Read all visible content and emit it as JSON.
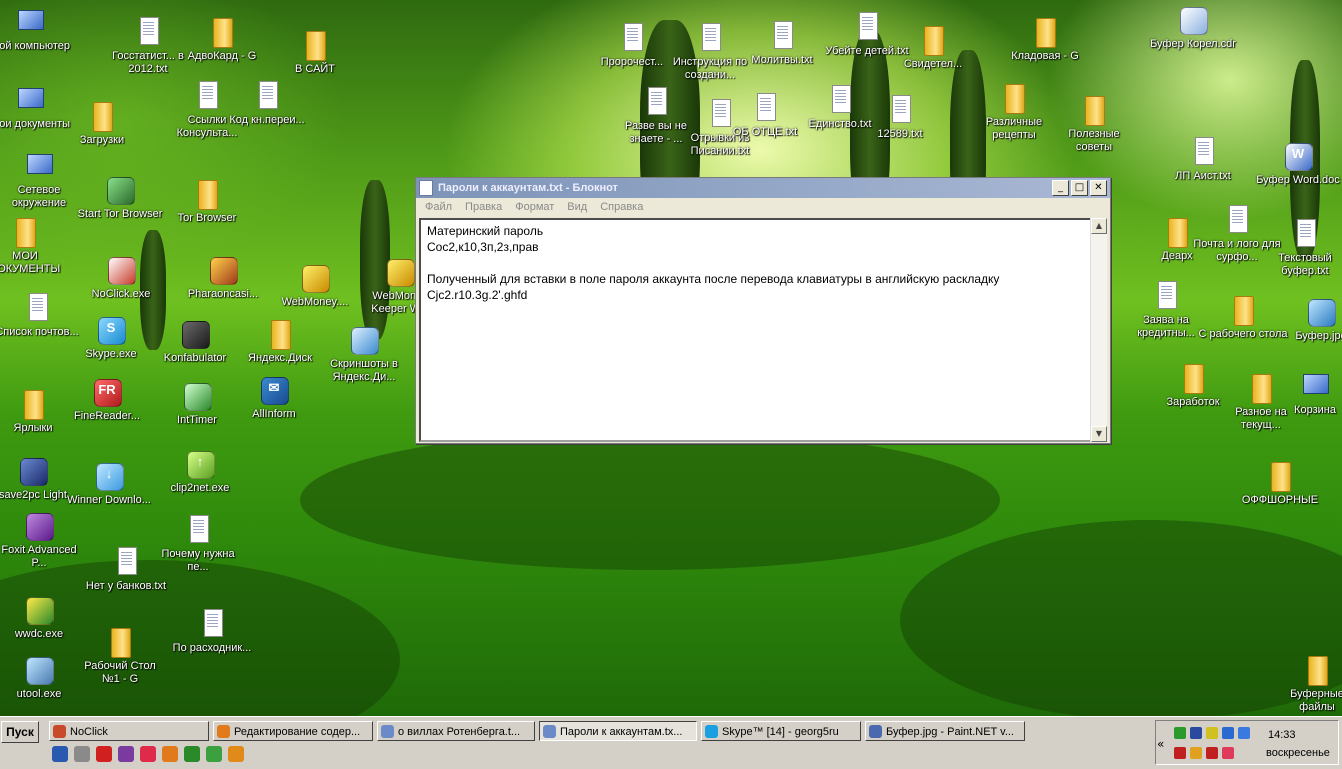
{
  "desktop": {
    "icons": [
      {
        "label": "Мой компьютер",
        "kind": "sys"
      },
      {
        "label": "Госстатист... в 2012.txt",
        "kind": "txt"
      },
      {
        "label": "АдвоКард - G",
        "kind": "folder"
      },
      {
        "label": "В САЙТ",
        "kind": "folder"
      },
      {
        "label": "Пророчест...",
        "kind": "txt"
      },
      {
        "label": "Инструкция по создани...",
        "kind": "txt"
      },
      {
        "label": "Молитвы.txt",
        "kind": "txt"
      },
      {
        "label": "Убейте детей.txt",
        "kind": "txt"
      },
      {
        "label": "Свидетел...",
        "kind": "folder"
      },
      {
        "label": "Кладовая - G",
        "kind": "folder"
      },
      {
        "label": "Буфер Корел.cdr",
        "kind": "app"
      },
      {
        "label": "Мои документы",
        "kind": "sys"
      },
      {
        "label": "Загрузки",
        "kind": "folder"
      },
      {
        "label": "Ссылки Консульта...",
        "kind": "txt"
      },
      {
        "label": "Код кн.переи...",
        "kind": "txt"
      },
      {
        "label": "Разве вы не знаете - ...",
        "kind": "txt"
      },
      {
        "label": "Отрывки из Писании.txt",
        "kind": "txt"
      },
      {
        "label": "ОБ ОТЦЕ.txt",
        "kind": "txt"
      },
      {
        "label": "Единство.txt",
        "kind": "txt"
      },
      {
        "label": "12589.txt",
        "kind": "txt"
      },
      {
        "label": "Различные рецепты",
        "kind": "folder"
      },
      {
        "label": "Полезные советы",
        "kind": "folder"
      },
      {
        "label": "Сетевое окружение",
        "kind": "sys"
      },
      {
        "label": "Start Tor Browser",
        "kind": "app"
      },
      {
        "label": "Tor Browser",
        "kind": "folder"
      },
      {
        "label": "ЛП Аист.txt",
        "kind": "txt"
      },
      {
        "label": "Буфер Word.doc",
        "kind": "app"
      },
      {
        "label": "МОИ ДОКУМЕНТЫ",
        "kind": "folder"
      },
      {
        "label": "NoClick.exe",
        "kind": "app"
      },
      {
        "label": "Pharaoncasi...",
        "kind": "app"
      },
      {
        "label": "WebMoney....",
        "kind": "app"
      },
      {
        "label": "WebMoney Keeper W...",
        "kind": "app"
      },
      {
        "label": "Деарх",
        "kind": "folder"
      },
      {
        "label": "Почта и лого для сурфо...",
        "kind": "txt"
      },
      {
        "label": "Текстовый буфер.txt",
        "kind": "txt"
      },
      {
        "label": "Список почтов...",
        "kind": "txt"
      },
      {
        "label": "Skype.exe",
        "kind": "app"
      },
      {
        "label": "Konfabulator",
        "kind": "app"
      },
      {
        "label": "Яндекс.Диск",
        "kind": "folder"
      },
      {
        "label": "Скриншоты в Яндекс.Ди...",
        "kind": "app"
      },
      {
        "label": "Заява на кредитны...",
        "kind": "txt"
      },
      {
        "label": "С рабочего стола",
        "kind": "folder"
      },
      {
        "label": "Буфер.jpg",
        "kind": "app"
      },
      {
        "label": "Ярлыки",
        "kind": "folder"
      },
      {
        "label": "FineReader...",
        "kind": "app"
      },
      {
        "label": "IntTimer",
        "kind": "app"
      },
      {
        "label": "AllInform",
        "kind": "app"
      },
      {
        "label": "Заработок",
        "kind": "folder"
      },
      {
        "label": "Разное на текущ...",
        "kind": "folder"
      },
      {
        "label": "Корзина",
        "kind": "sys"
      },
      {
        "label": "save2pc Light",
        "kind": "app"
      },
      {
        "label": "Winner Downlo...",
        "kind": "app"
      },
      {
        "label": "clip2net.exe",
        "kind": "app"
      },
      {
        "label": "ОФФШОРНЫЕ",
        "kind": "folder"
      },
      {
        "label": "Foxit Advanced P...",
        "kind": "app"
      },
      {
        "label": "Почему нужна пе...",
        "kind": "txt"
      },
      {
        "label": "Нет у банков.txt",
        "kind": "txt"
      },
      {
        "label": "wwdc.exe",
        "kind": "app"
      },
      {
        "label": "По расходник...",
        "kind": "txt"
      },
      {
        "label": "Рабочий Стол №1 - G",
        "kind": "folder"
      },
      {
        "label": "utool.exe",
        "kind": "app"
      },
      {
        "label": "Буферные файлы",
        "kind": "folder"
      }
    ]
  },
  "notepad": {
    "title": "Пароли к аккаунтам.txt - Блокнот",
    "min_glyph": "_",
    "max_glyph": "□",
    "close_glyph": "✕",
    "menu": [
      "Файл",
      "Правка",
      "Формат",
      "Вид",
      "Справка"
    ],
    "content": "Материнский пароль\nСос2,к10,3п,2з,прав\n\nПолученный для вставки в поле пароля аккаунта после перевода клавиатуры в английскую раскладку\nCjc2.r10.3g.2'.ghfd",
    "scroll_up": "▲",
    "scroll_down": "▼"
  },
  "taskbar": {
    "start_label": "Пуск",
    "buttons": [
      {
        "label": "NoClick",
        "color": "#c84a2a",
        "active": false
      },
      {
        "label": "Редактирование содер...",
        "color": "#e07a1a",
        "active": false
      },
      {
        "label": "о виллах Ротенберга.t...",
        "color": "#6a8ac8",
        "active": false
      },
      {
        "label": "Пароли к аккаунтам.tx...",
        "color": "#6a8ac8",
        "active": true
      },
      {
        "label": "Skype™ [14] - georg5ru",
        "color": "#1aa0e0",
        "active": false
      },
      {
        "label": "Буфер.jpg - Paint.NET v...",
        "color": "#4a6ab0",
        "active": false
      }
    ],
    "quick_launch_colors": [
      "#2a5ab0",
      "#8a8a8a",
      "#d02020",
      "#7a3aa0",
      "#e02a4a",
      "#e07a1a",
      "#2a8a2a",
      "#3aa040",
      "#e08a1a"
    ],
    "tray_arrow": "«",
    "tray_colors": [
      "#2a9a2a",
      "#2a4aa0",
      "#d0c020",
      "#2a6ad0",
      "#3a7ae0",
      "#c02020",
      "#e0a020",
      "#c02020",
      "#e03a5a"
    ],
    "clock": "14:33",
    "day": "воскресенье"
  }
}
